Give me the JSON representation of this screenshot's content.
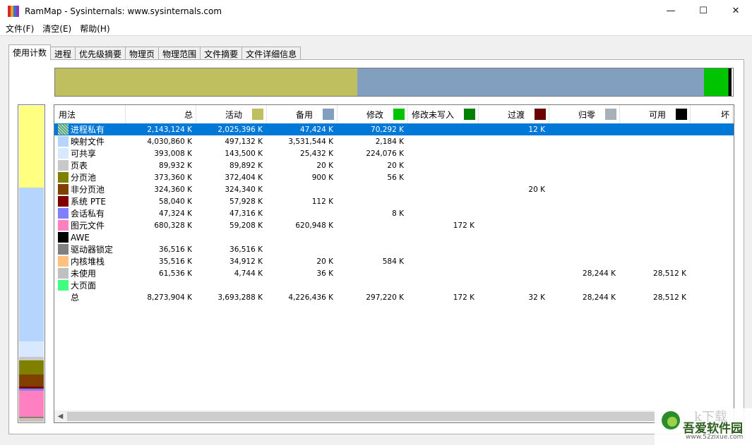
{
  "window": {
    "title": "RamMap - Sysinternals: www.sysinternals.com",
    "min_glyph": "—",
    "max_glyph": "☐",
    "close_glyph": "✕"
  },
  "menu": [
    "文件(F)",
    "清空(E)",
    "帮助(H)"
  ],
  "tabs": [
    "使用计数",
    "进程",
    "优先级摘要",
    "物理页",
    "物理范围",
    "文件摘要",
    "文件详细信息"
  ],
  "active_tab": 0,
  "columns": [
    {
      "label": "用法",
      "color": null
    },
    {
      "label": "总",
      "color": null
    },
    {
      "label": "活动",
      "color": "#bfbf5f"
    },
    {
      "label": "备用",
      "color": "#839fbf"
    },
    {
      "label": "修改",
      "color": "#00c400"
    },
    {
      "label": "修改未写入",
      "color": "#008000"
    },
    {
      "label": "过渡",
      "color": "#6b0000"
    },
    {
      "label": "归零",
      "color": "#a8b0b8"
    },
    {
      "label": "可用",
      "color": "#000000"
    },
    {
      "label": "坏",
      "color": null
    }
  ],
  "rows": [
    {
      "name": "进程私有",
      "color": "#7fbf9f",
      "pattern": true,
      "values": [
        "2,143,124 K",
        "2,025,396 K",
        "47,424 K",
        "70,292 K",
        "",
        "12 K",
        "",
        ""
      ],
      "selected": true
    },
    {
      "name": "映射文件",
      "color": "#b5d5ff",
      "values": [
        "4,030,860 K",
        "497,132 K",
        "3,531,544 K",
        "2,184 K",
        "",
        "",
        "",
        ""
      ]
    },
    {
      "name": "可共享",
      "color": "#d8e8ff",
      "values": [
        "393,008 K",
        "143,500 K",
        "25,432 K",
        "224,076 K",
        "",
        "",
        "",
        ""
      ]
    },
    {
      "name": "页表",
      "color": "#c8c8c8",
      "values": [
        "89,932 K",
        "89,892 K",
        "20 K",
        "20 K",
        "",
        "",
        "",
        ""
      ]
    },
    {
      "name": "分页池",
      "color": "#808000",
      "values": [
        "373,360 K",
        "372,404 K",
        "900 K",
        "56 K",
        "",
        "",
        "",
        ""
      ]
    },
    {
      "name": "非分页池",
      "color": "#804000",
      "values": [
        "324,360 K",
        "324,340 K",
        "",
        "",
        "",
        "20 K",
        "",
        ""
      ]
    },
    {
      "name": "系统 PTE",
      "color": "#800000",
      "values": [
        "58,040 K",
        "57,928 K",
        "112 K",
        "",
        "",
        "",
        "",
        ""
      ]
    },
    {
      "name": "会话私有",
      "color": "#8080ff",
      "values": [
        "47,324 K",
        "47,316 K",
        "",
        "8 K",
        "",
        "",
        "",
        ""
      ]
    },
    {
      "name": "图元文件",
      "color": "#ff80c0",
      "values": [
        "680,328 K",
        "59,208 K",
        "620,948 K",
        "",
        "172 K",
        "",
        "",
        ""
      ]
    },
    {
      "name": "AWE",
      "color": "#000000",
      "values": [
        "",
        "",
        "",
        "",
        "",
        "",
        "",
        ""
      ]
    },
    {
      "name": "驱动器锁定",
      "color": "#808080",
      "values": [
        "36,516 K",
        "36,516 K",
        "",
        "",
        "",
        "",
        "",
        ""
      ]
    },
    {
      "name": "内核堆栈",
      "color": "#ffc080",
      "values": [
        "35,516 K",
        "34,912 K",
        "20 K",
        "584 K",
        "",
        "",
        "",
        ""
      ]
    },
    {
      "name": "未使用",
      "color": "#c0c0c0",
      "values": [
        "61,536 K",
        "4,744 K",
        "36 K",
        "",
        "",
        "",
        "28,244 K",
        "28,512 K"
      ]
    },
    {
      "name": "大页面",
      "color": "#40ff80",
      "values": [
        "",
        "",
        "",
        "",
        "",
        "",
        "",
        ""
      ]
    },
    {
      "name": "总",
      "color": null,
      "values": [
        "8,273,904 K",
        "3,693,288 K",
        "4,226,436 K",
        "297,220 K",
        "172 K",
        "32 K",
        "28,244 K",
        "28,512 K"
      ]
    }
  ],
  "top_bar": [
    {
      "label": "活动",
      "color": "#bfbf5f",
      "fraction": 0.446
    },
    {
      "label": "备用",
      "color": "#839fbf",
      "fraction": 0.511
    },
    {
      "label": "修改",
      "color": "#00c400",
      "fraction": 0.036
    },
    {
      "label": "修改未写入",
      "color": "#008000",
      "fraction": 0.001
    },
    {
      "label": "可用",
      "color": "#000000",
      "fraction": 0.004
    },
    {
      "label": "归零",
      "color": "#ffffff",
      "fraction": 0.002
    }
  ],
  "left_bar": [
    {
      "label": "进程私有",
      "color": "#ffff80",
      "fraction": 0.259
    },
    {
      "label": "映射文件",
      "color": "#b5d5ff",
      "fraction": 0.487
    },
    {
      "label": "可共享",
      "color": "#d8e8ff",
      "fraction": 0.048
    },
    {
      "label": "页表",
      "color": "#c8c8c8",
      "fraction": 0.011
    },
    {
      "label": "分页池",
      "color": "#808000",
      "fraction": 0.045
    },
    {
      "label": "非分页池",
      "color": "#804000",
      "fraction": 0.039
    },
    {
      "label": "系统 PTE",
      "color": "#800000",
      "fraction": 0.007
    },
    {
      "label": "会话私有",
      "color": "#8080ff",
      "fraction": 0.006
    },
    {
      "label": "图元文件",
      "color": "#ff80c0",
      "fraction": 0.082
    },
    {
      "label": "驱动器锁定",
      "color": "#808080",
      "fraction": 0.004
    },
    {
      "label": "内核堆栈",
      "color": "#ffc080",
      "fraction": 0.004
    },
    {
      "label": "未使用",
      "color": "#c0c0c0",
      "fraction": 0.008
    }
  ],
  "watermark": {
    "big": "吾爱软件园",
    "url": "www.52zixue.com",
    "top": "k下载"
  }
}
